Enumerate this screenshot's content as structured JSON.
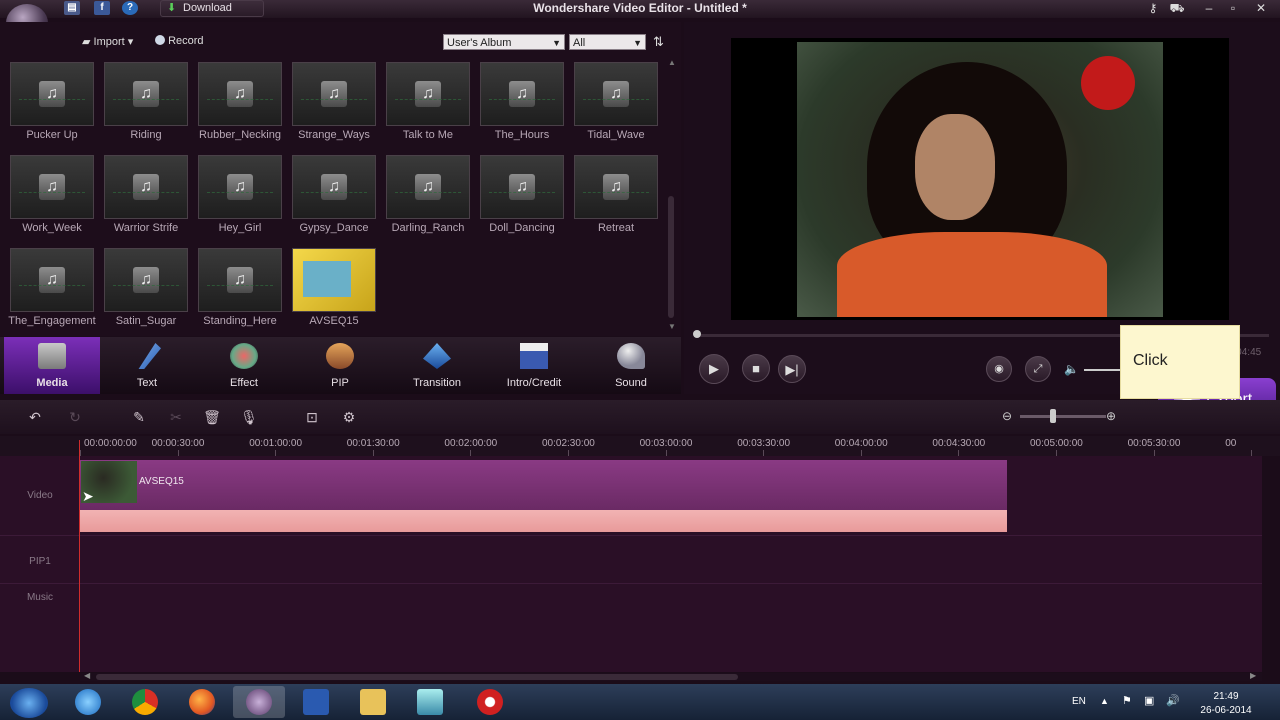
{
  "window": {
    "title": "Wondershare Video Editor - Untitled *",
    "download_label": "Download"
  },
  "media_toolbar": {
    "import_label": "Import",
    "record_label": "Record",
    "album_select": "User's Album",
    "filter_select": "All"
  },
  "media_items": [
    {
      "label": "Pucker Up",
      "type": "audio"
    },
    {
      "label": "Riding",
      "type": "audio"
    },
    {
      "label": "Rubber_Necking",
      "type": "audio"
    },
    {
      "label": "Strange_Ways",
      "type": "audio"
    },
    {
      "label": "Talk to Me",
      "type": "audio"
    },
    {
      "label": "The_Hours",
      "type": "audio"
    },
    {
      "label": "Tidal_Wave",
      "type": "audio"
    },
    {
      "label": "Work_Week",
      "type": "audio"
    },
    {
      "label": "Warrior Strife",
      "type": "audio"
    },
    {
      "label": "Hey_Girl",
      "type": "audio"
    },
    {
      "label": "Gypsy_Dance",
      "type": "audio"
    },
    {
      "label": "Darling_Ranch",
      "type": "audio"
    },
    {
      "label": "Doll_Dancing",
      "type": "audio"
    },
    {
      "label": "Retreat",
      "type": "audio"
    },
    {
      "label": "The_Engagement",
      "type": "audio"
    },
    {
      "label": "Satin_Sugar",
      "type": "audio"
    },
    {
      "label": "Standing_Here",
      "type": "audio"
    },
    {
      "label": "AVSEQ15",
      "type": "video"
    }
  ],
  "tabs": [
    "Media",
    "Text",
    "Effect",
    "PIP",
    "Transition",
    "Intro/Credit",
    "Sound"
  ],
  "preview": {
    "time": "00:00:00 / 00:04:45"
  },
  "tooltip": {
    "text": "Click"
  },
  "export": {
    "label": "Export"
  },
  "ruler_ticks": [
    "00:00:00:00",
    "00:00:30:00",
    "00:01:00:00",
    "00:01:30:00",
    "00:02:00:00",
    "00:02:30:00",
    "00:03:00:00",
    "00:03:30:00",
    "00:04:00:00",
    "00:04:30:00",
    "00:05:00:00",
    "00:05:30:00",
    "00"
  ],
  "tracks": {
    "video": "Video",
    "pip": "PIP1",
    "music": "Music",
    "clip_label": "AVSEQ15"
  },
  "taskbar": {
    "lang": "EN",
    "time": "21:49",
    "date": "26-06-2014"
  },
  "colors": {
    "accent": "#7b2fb8",
    "timeline_bg": "#2a0f26",
    "clip": "#7a3274",
    "audio_clip": "#f0a8a8",
    "playhead": "#d02c2c"
  }
}
